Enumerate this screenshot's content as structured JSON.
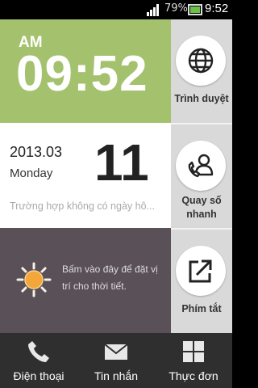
{
  "status_bar": {
    "battery_percent": "79%",
    "time": "9:52",
    "battery_color": "#6cc04a"
  },
  "clock": {
    "ampm": "AM",
    "time": "09:52",
    "bg_color": "#a4c26d"
  },
  "calendar": {
    "year_month": "2013.03",
    "weekday": "Monday",
    "day": "11",
    "event_text": "Trường hợp không có ngày hô..."
  },
  "weather": {
    "prompt": "Bấm vào đây để đặt vị trí cho thời tiết.",
    "icon": "sun-icon",
    "bg_color": "#5a5058"
  },
  "shortcuts": [
    {
      "label": "Trình duyệt",
      "icon": "globe-icon"
    },
    {
      "label": "Quay số nhanh",
      "icon": "speed-dial-contact-icon"
    },
    {
      "label": "Phím tắt",
      "icon": "shortcut-arrow-icon"
    }
  ],
  "bottom_nav": [
    {
      "label": "Điện thoại",
      "icon": "phone-icon"
    },
    {
      "label": "Tin nhắn",
      "icon": "envelope-icon"
    },
    {
      "label": "Thực đơn",
      "icon": "grid-menu-icon"
    }
  ]
}
